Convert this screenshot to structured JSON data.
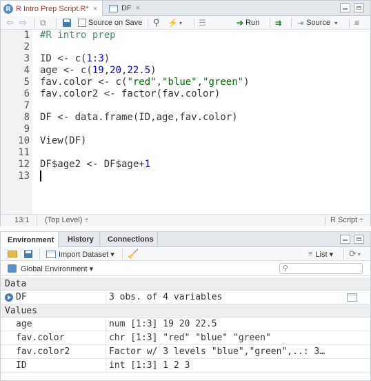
{
  "editor": {
    "tabs": [
      {
        "label": "R Intro Prep Script.R*",
        "close": "×"
      },
      {
        "label": "DF",
        "close": "×"
      }
    ],
    "toolbar": {
      "source_on_save_label": "Source on Save",
      "run_label": "Run",
      "source_label": "Source"
    },
    "lines": [
      {
        "num": "1",
        "text": "#R intro prep"
      },
      {
        "num": "2",
        "text": ""
      },
      {
        "num": "3",
        "text": "ID <- c(1:3)"
      },
      {
        "num": "4",
        "text": "age <- c(19,20,22.5)"
      },
      {
        "num": "5",
        "text": "fav.color <- c(\"red\",\"blue\",\"green\")"
      },
      {
        "num": "6",
        "text": "fav.color2 <- factor(fav.color)"
      },
      {
        "num": "7",
        "text": ""
      },
      {
        "num": "8",
        "text": "DF <- data.frame(ID,age,fav.color)"
      },
      {
        "num": "9",
        "text": ""
      },
      {
        "num": "10",
        "text": "View(DF)"
      },
      {
        "num": "11",
        "text": ""
      },
      {
        "num": "12",
        "text": "DF$age2 <- DF$age+1"
      },
      {
        "num": "13",
        "text": ""
      }
    ],
    "status": {
      "position": "13:1",
      "scope": "(Top Level) ÷",
      "file_type": "R Script ÷"
    }
  },
  "environment": {
    "tabs": [
      "Environment",
      "History",
      "Connections"
    ],
    "toolbar": {
      "import_label": "Import Dataset ▾",
      "list_label": "List ▾",
      "scope_label": "Global Environment ▾"
    },
    "search": {
      "placeholder": "",
      "value": ""
    },
    "sections": {
      "data_header": "Data",
      "values_header": "Values"
    },
    "data_rows": [
      {
        "name": "DF",
        "value": "3 obs. of 4 variables"
      }
    ],
    "value_rows": [
      {
        "name": "age",
        "value": "num [1:3] 19 20 22.5"
      },
      {
        "name": "fav.color",
        "value": "chr [1:3] \"red\" \"blue\" \"green\""
      },
      {
        "name": "fav.color2",
        "value": "Factor w/ 3 levels \"blue\",\"green\",..: 3…"
      },
      {
        "name": "ID",
        "value": "int [1:3] 1 2 3"
      }
    ]
  },
  "colors": {
    "comment": "#4c886b",
    "string": "#036a07",
    "number": "#0000cd",
    "r_script_tab_text": "#b23a2f"
  }
}
